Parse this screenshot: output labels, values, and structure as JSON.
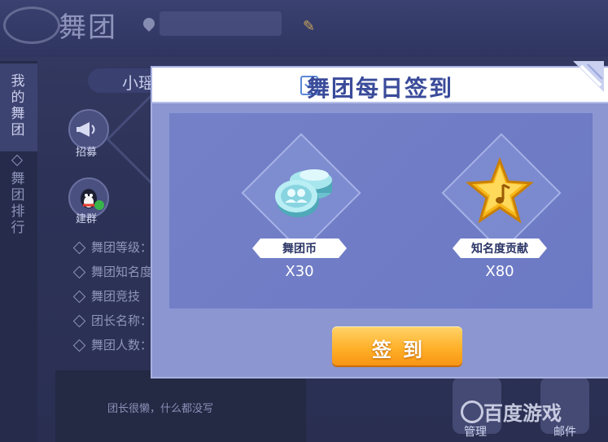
{
  "header": {
    "logo_text": "舞团"
  },
  "sidebar": {
    "items": [
      {
        "label": "我的舞团",
        "active": true
      },
      {
        "label": "舞团排行",
        "active": false
      }
    ]
  },
  "profile": {
    "name_prefix": "小瑶"
  },
  "actions": [
    {
      "label": "招募",
      "icon": "megaphone-icon"
    },
    {
      "label": "建群",
      "icon": "qq-penguin-icon"
    }
  ],
  "info": [
    "舞团等级：",
    "舞团知名度",
    "舞团竞技",
    "团长名称：",
    "舞团人数："
  ],
  "motto": "团长很懒，什么都没写",
  "corner_buttons": [
    {
      "label": "管理",
      "icon": "admin-icon"
    },
    {
      "label": "邮件",
      "icon": "mail-icon"
    }
  ],
  "watermark": "百度游戏",
  "dialog": {
    "title": "舞团每日签到",
    "rewards": [
      {
        "name": "舞团币",
        "amount": "X30",
        "icon": "dance-coins-icon"
      },
      {
        "name": "知名度贡献",
        "amount": "X80",
        "icon": "music-star-icon"
      }
    ],
    "confirm_label": "签到"
  },
  "colors": {
    "dialog_bg": "#8c96d0",
    "panel_bg": "#6c79c4",
    "title": "#3a4b9a",
    "button": "#ffb12a"
  }
}
